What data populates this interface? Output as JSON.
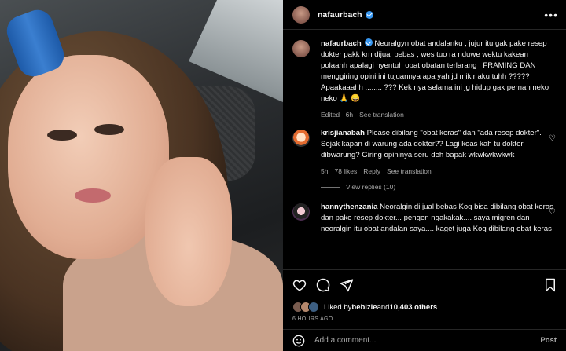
{
  "post": {
    "username": "nafaurbach",
    "menu_icon": "more-horizontal-icon"
  },
  "caption": {
    "username": "nafaurbach",
    "text": "Neuralgyn obat andalanku , jujur itu gak pake resep dokter pakk krn dijual bebas , wes tuo ra nduwe wektu kakean polaahh apalagi nyentuh obat obatan terlarang . FRAMING DAN menggiring opini ini tujuannya apa yah jd mikir aku tuhh ????? Apaakaaahh ........ ??? Kek nya selama ini jg hidup gak pernah neko neko 🙏 😄",
    "time": "Edited · 6h",
    "see_translation": "See translation"
  },
  "comments": [
    {
      "username": "krisjianabah",
      "text": "Please dibilang \"obat keras\" dan \"ada resep dokter\". Sejak kapan di warung ada dokter?? Lagi koas kah tu dokter dibwarung? Giring opininya seru deh bapak wkwkwkwkwk",
      "time": "5h",
      "likes": "78 likes",
      "reply": "Reply",
      "see_translation": "See translation",
      "view_replies": "View replies (10)"
    },
    {
      "username": "hannythenzania",
      "text": "Neoralgin di jual bebas Koq bisa dibilang obat keras dan pake resep dokter... pengen ngakakak.... saya migren dan neoralgin itu obat andalan saya.... kaget juga Koq dibilang obat keras"
    }
  ],
  "likes_row": {
    "prefix": "Liked by ",
    "user": "bebizie",
    "mid": " and ",
    "count": "10,403 others"
  },
  "timestamp": "6 HOURS AGO",
  "add_comment": {
    "placeholder": "Add a comment...",
    "post_label": "Post"
  }
}
